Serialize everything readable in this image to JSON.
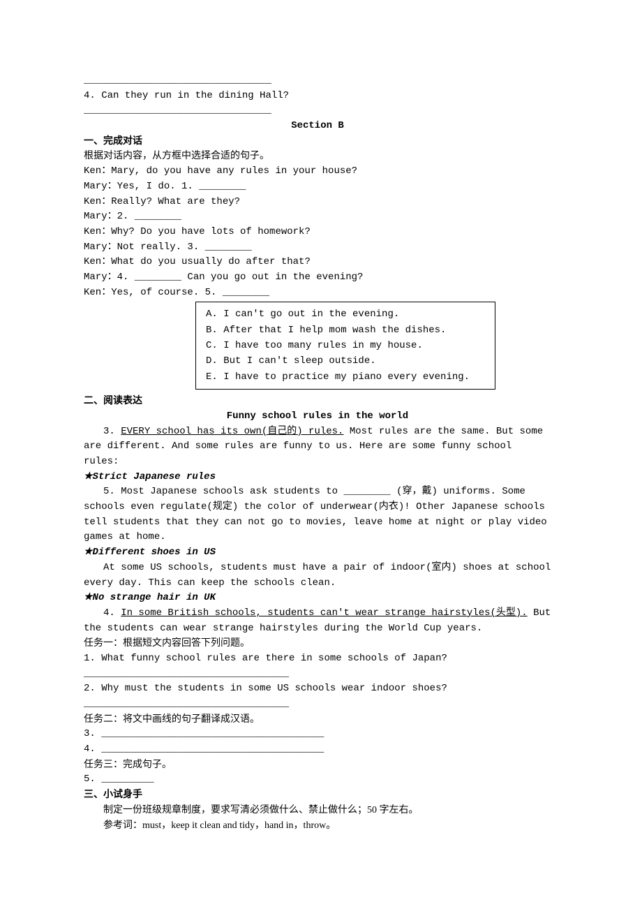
{
  "top": {
    "blank1": "  ________________________________",
    "q4": "4. Can they run in the dining Hall?",
    "blank2": "  ________________________________"
  },
  "sectionB": {
    "title": "Section B",
    "partA": {
      "heading": "一、完成对话",
      "sub": "根据对话内容，从方框中选择合适的句子。",
      "lines": [
        "Ken：Mary, do you have any rules in your house?",
        "Mary：Yes, I do. 1. ________",
        "Ken：Really? What are they?",
        "Mary：2. ________",
        "Ken：Why? Do you have lots of homework?",
        "Mary：Not really. 3. ________",
        "Ken：What do you usually do after that?",
        "Mary：4. ________ Can you go out in the evening?",
        "Ken：Yes, of course. 5. ________"
      ],
      "options": [
        "A. I can't go out in the evening.",
        "B. After that I help mom wash the dishes.",
        "C. I have too many rules in my house.",
        "D. But I can't sleep outside.",
        "E. I have to practice my piano every evening."
      ]
    },
    "partB": {
      "heading": "二、阅读表达",
      "title": "Funny school rules in the world",
      "p1_pre": "3. ",
      "p1_u": "EVERY school has its own(自己的) rules.",
      "p1_post": " Most rules are the same. But some are different. And some rules are funny to us. Here are some funny school rules:",
      "h1": "★Strict Japanese rules",
      "p2": "5. Most Japanese schools ask students to ________ (穿，戴) uniforms. Some schools even regulate(规定) the color of underwear(内衣)! Other Japanese schools tell students that they can not go to movies, leave home at night or play video games at home.",
      "h2": "★Different shoes in US",
      "p3": "At some US schools, students must have a pair of indoor(室内) shoes at school every day. This can keep the schools clean.",
      "h3": "★No strange hair in UK",
      "p4_pre": "4. ",
      "p4_u": "In some British schools, students can't wear strange hairstyles(头型).",
      "p4_post": " But the students can wear strange hairstyles during the World Cup years.",
      "task1": "任务一：根据短文内容回答下列问题。",
      "q1": "1. What funny school rules are there in some schools of Japan?",
      "blank1": "  ___________________________________",
      "q2": "2. Why must the students in some US schools wear indoor shoes?",
      "blank2": "  ___________________________________",
      "task2": "任务二：将文中画线的句子翻译成汉语。",
      "q3": "3. ______________________________________",
      "q4": "4. ______________________________________",
      "task3": "任务三：完成句子。",
      "q5": "5. _________"
    },
    "partC": {
      "heading": "三、小试身手",
      "line1": "制定一份班级规章制度，要求写清必须做什么、禁止做什么；50 字左右。",
      "line2": "参考词：must，keep it clean and tidy，hand in，throw。"
    }
  }
}
